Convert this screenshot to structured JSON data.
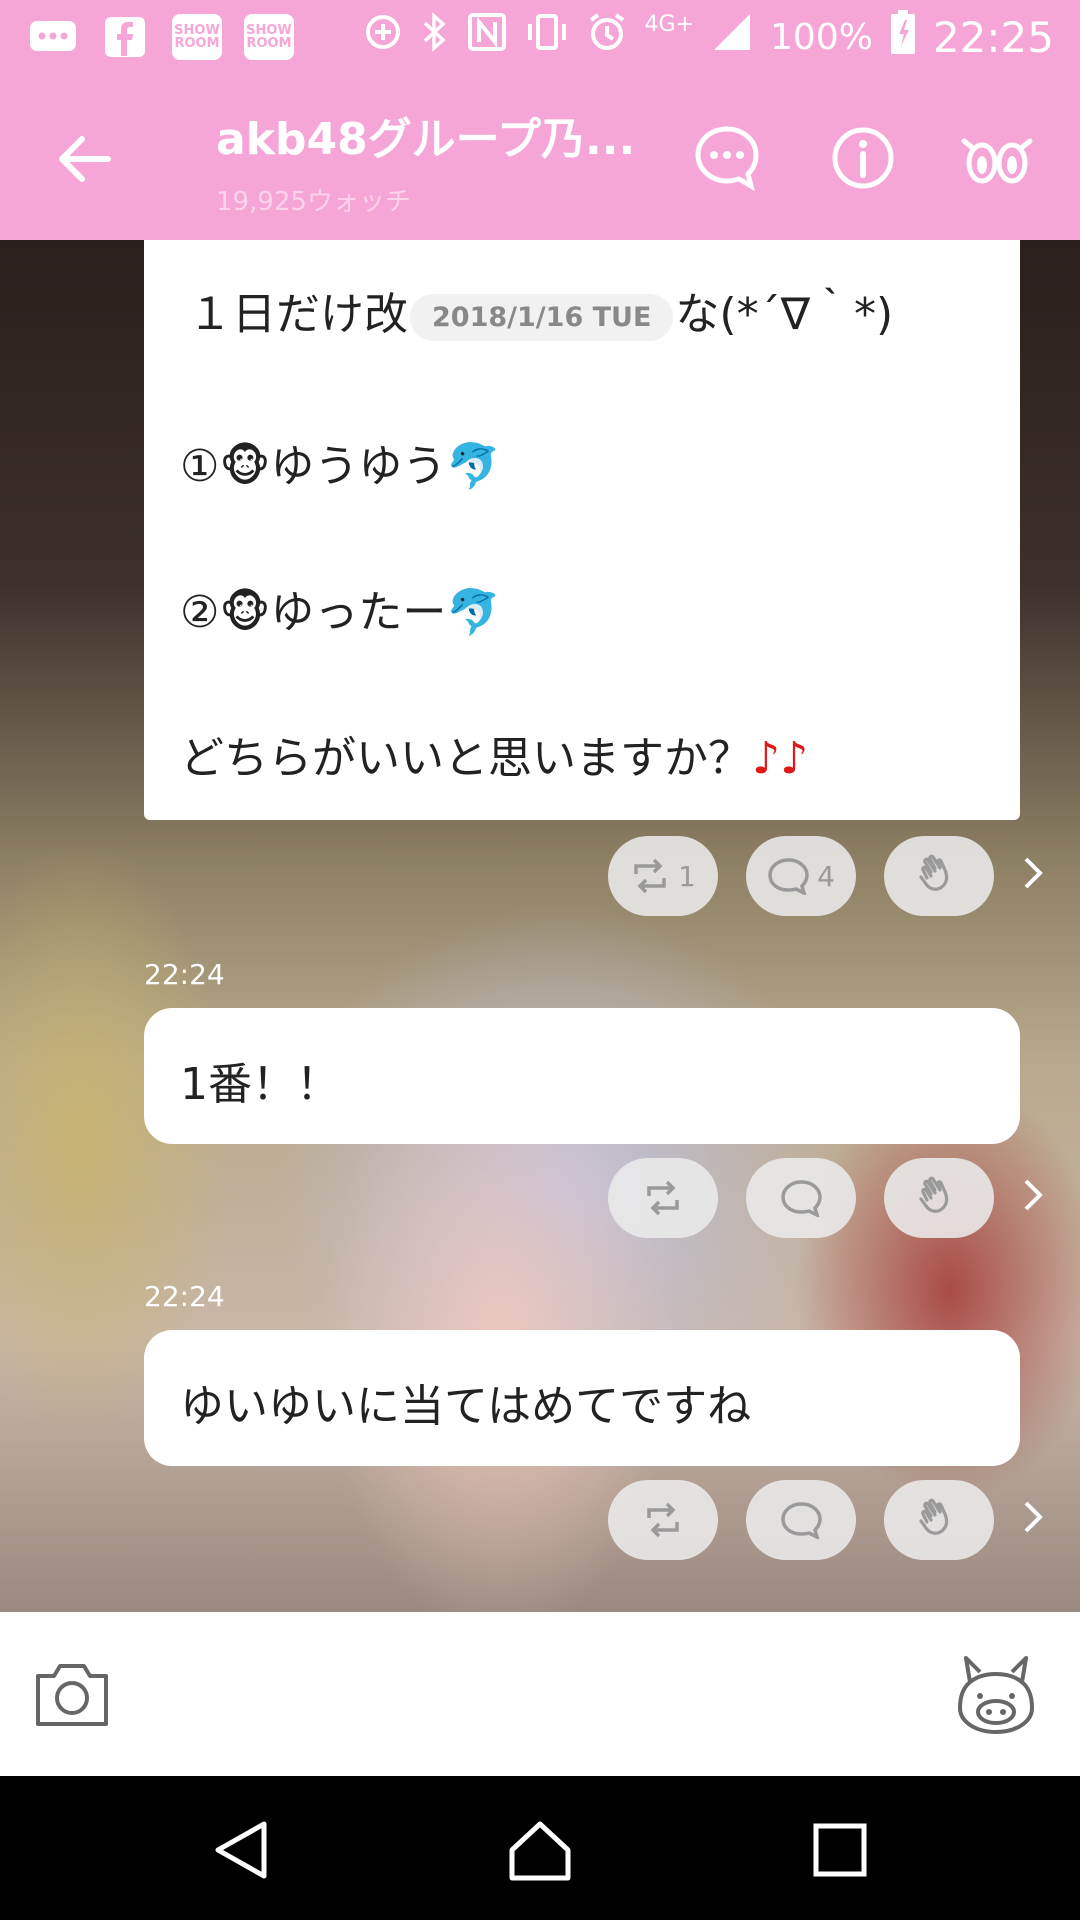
{
  "status_bar": {
    "network": "4G+",
    "battery": "100%",
    "time": "22:25",
    "left_icons": [
      "chat-bubble-icon",
      "facebook-icon",
      "showroom-icon",
      "showroom-icon"
    ],
    "showroom_label": "SHOW ROOM",
    "right_icons": [
      "data-saver-icon",
      "bluetooth-icon",
      "nfc-icon",
      "vibrate-icon",
      "alarm-icon",
      "signal-icon",
      "battery-icon"
    ]
  },
  "app_bar": {
    "title": "akb48グループ乃...",
    "watch_count": "19,925ウォッチ",
    "icons": [
      "back-arrow-icon",
      "chat-icon",
      "info-icon",
      "watch-eyes-icon"
    ]
  },
  "post": {
    "line1_before": "１日だけ改",
    "date_overlay": "2018/1/16 TUE",
    "line1_after": "な(*´∇｀*)",
    "option1": "①🐵ゆうゆう🐬",
    "option2": "②🐵ゆったー🐬",
    "question": "どちらがいいと思いますか？",
    "question_notes": "♪♪",
    "retweet_count": "1",
    "comment_count": "4"
  },
  "messages": [
    {
      "time": "22:24",
      "text": "1番！！"
    },
    {
      "time": "22:24",
      "text": "ゆいゆいに当てはめてですね"
    }
  ],
  "input_bar": {
    "icons": [
      "camera-icon",
      "stamp-icon"
    ]
  },
  "nav_bar": {
    "icons": [
      "back-triangle-icon",
      "home-icon",
      "recents-icon"
    ]
  }
}
